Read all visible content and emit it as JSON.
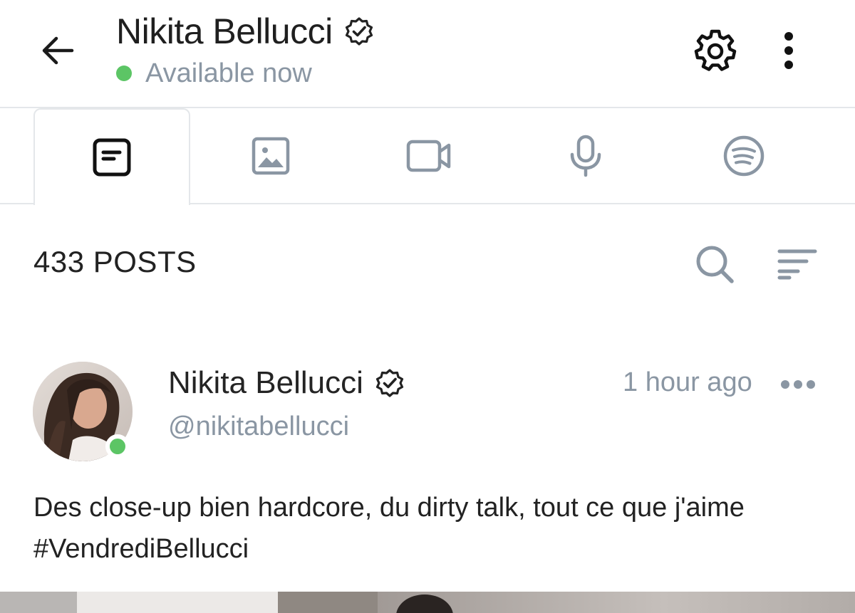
{
  "header": {
    "title": "Nikita Bellucci",
    "status_text": "Available now",
    "icons": {
      "back": "arrow-left-icon",
      "verified": "verified-badge-icon",
      "settings": "gear-icon",
      "more": "more-vertical-icon"
    },
    "colors": {
      "status_dot": "#5cc565",
      "muted_text": "#8a96a3"
    }
  },
  "tabs": [
    {
      "icon": "text-post-icon",
      "active": true
    },
    {
      "icon": "image-icon",
      "active": false
    },
    {
      "icon": "video-camera-icon",
      "active": false
    },
    {
      "icon": "microphone-icon",
      "active": false
    },
    {
      "icon": "spotify-icon",
      "active": false
    }
  ],
  "posts_bar": {
    "count_label": "433 POSTS",
    "icons": {
      "search": "search-icon",
      "sort": "sort-lines-icon"
    }
  },
  "post": {
    "author_name": "Nikita Bellucci",
    "handle": "@nikitabellucci",
    "time": "1 hour ago",
    "text_line1": "Des close-up bien hardcore, du dirty talk, tout ce que j'aime",
    "text_line2": "#VendrediBellucci",
    "icons": {
      "verified": "verified-badge-icon",
      "more": "more-horizontal-icon"
    }
  }
}
